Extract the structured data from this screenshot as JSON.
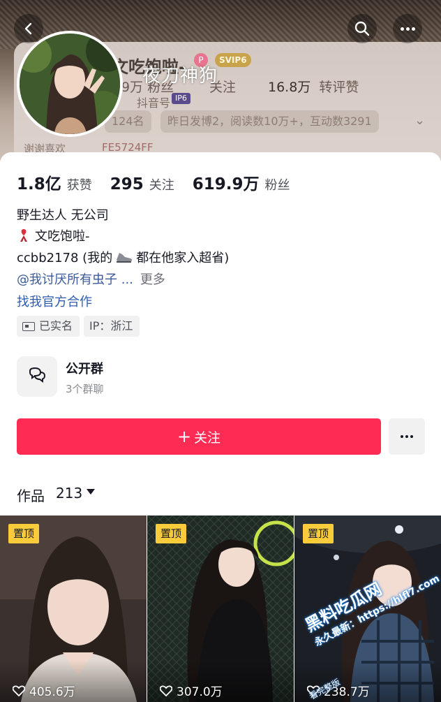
{
  "header": {
    "name_partial": "文吃饱啦-",
    "svip_badge": "SVIP6",
    "ip6_badge": "IP6",
    "account_partial": "抖音号",
    "watermark": "夜刀神狗",
    "stat_left": "9万",
    "stat_left_label": "粉丝",
    "stat_mid_label": "关注",
    "stat_right": "16.8万",
    "stat_right_label": "转评赞",
    "pill_rank": "124名",
    "pill_activity": "昨日发博2，阅读数10万+，互动数3291",
    "row3_left": "谢谢喜欢",
    "row3_right": "FE5724FF"
  },
  "profile": {
    "likes_count": "1.8亿",
    "likes_label": "获赞",
    "following_count": "295",
    "following_label": "关注",
    "followers_count": "619.9万",
    "followers_label": "粉丝",
    "bio_line1": "野生达人 无公司",
    "bio_line2": "文吃饱啦-",
    "bio_line3": "ccbb2178 (我的",
    "bio_line3b": "都在他家入超省)",
    "bio_mention": "@我讨厌所有虫子 ...",
    "bio_more": "更多",
    "bio_cooperation": "找我官方合作",
    "tag_verified": "已实名",
    "tag_ip": "IP：浙江"
  },
  "group": {
    "title": "公开群",
    "subtitle": "3个群聊"
  },
  "actions": {
    "follow_label": "关注"
  },
  "works": {
    "label": "作品",
    "count": "213"
  },
  "thumbnails": [
    {
      "pin": "置顶",
      "likes": "405.6万"
    },
    {
      "pin": "置顶",
      "likes": "307.0万"
    },
    {
      "pin": "置顶",
      "likes": "238.7万"
    }
  ],
  "watermarks": {
    "site": "黑料吃瓜网",
    "site_url": "永久最新：https://hlfl7.com",
    "site_small": "看完整版"
  },
  "colors": {
    "follow_button": "#fe2c55",
    "pin_badge": "#facc3c",
    "link": "#3b5a9a"
  }
}
